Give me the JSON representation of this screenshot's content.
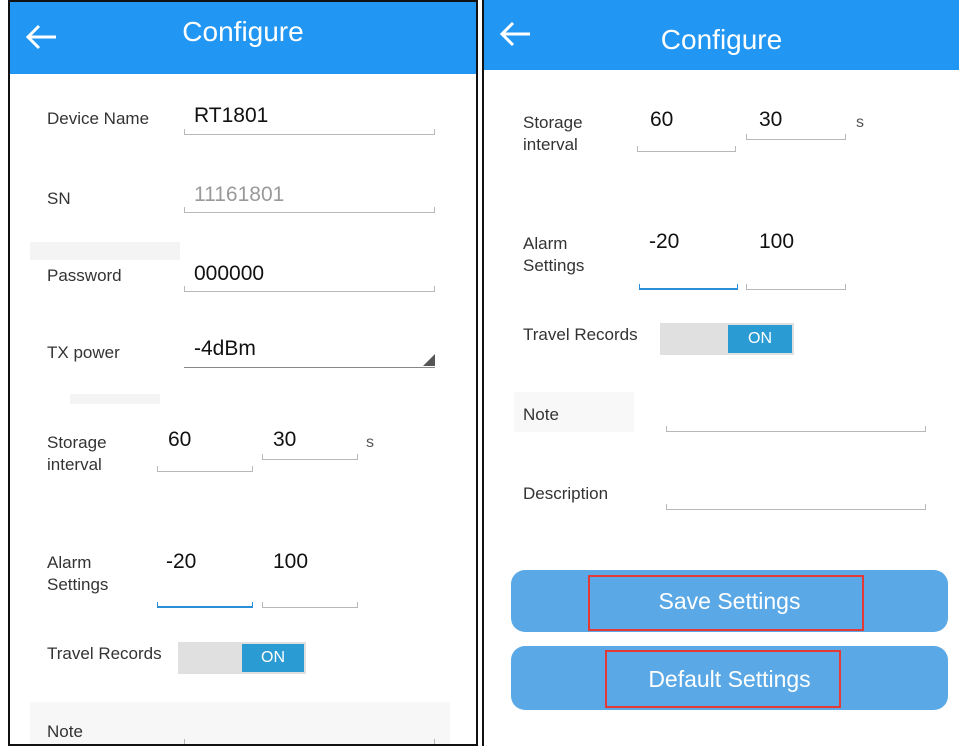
{
  "left_panel": {
    "title": "Configure",
    "device_name": {
      "label": "Device Name",
      "value": "RT1801"
    },
    "sn": {
      "label": "SN",
      "value": "11161801"
    },
    "password": {
      "label": "Password",
      "value": "000000"
    },
    "tx_power": {
      "label": "TX power",
      "value": "-4dBm"
    },
    "storage_interval": {
      "label_line1": "Storage",
      "label_line2": "interval",
      "value1": "60",
      "value2": "30",
      "unit": "s"
    },
    "alarm_settings": {
      "label_line1": "Alarm",
      "label_line2": "Settings",
      "low": "-20",
      "high": "100"
    },
    "travel_records": {
      "label": "Travel Records",
      "state": "ON"
    },
    "note": {
      "label": "Note"
    }
  },
  "right_panel": {
    "title": "Configure",
    "storage_interval": {
      "label_line1": "Storage",
      "label_line2": "interval",
      "value1": "60",
      "value2": "30",
      "unit": "s"
    },
    "alarm_settings": {
      "label_line1": "Alarm",
      "label_line2": "Settings",
      "low": "-20",
      "high": "100"
    },
    "travel_records": {
      "label": "Travel Records",
      "state": "ON"
    },
    "note": {
      "label": "Note",
      "value": ""
    },
    "description": {
      "label": "Description",
      "value": ""
    },
    "save_button": "Save Settings",
    "default_button": "Default Settings"
  },
  "icons": {
    "back": "arrow-left-icon",
    "dropdown": "dropdown-triangle-icon"
  },
  "colors": {
    "appbar": "#2196f3",
    "toggle_on": "#2b9bd3",
    "button": "#5aa9e6",
    "highlight": "#e53935",
    "focus_underline": "#2a8ed8"
  }
}
